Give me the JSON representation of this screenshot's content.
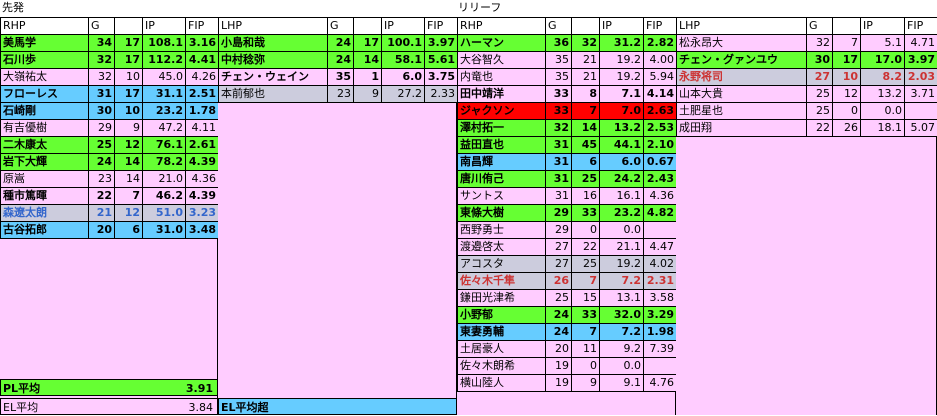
{
  "sections": {
    "starters": "先発",
    "relief": "リリーフ"
  },
  "columns": {
    "rhp": "RHP",
    "lhp": "LHP",
    "g": "G",
    "gs": "",
    "ip": "IP",
    "fip": "FIP"
  },
  "sp_rhp": [
    {
      "name": "美馬学",
      "g": "34",
      "gs": "17",
      "ip": "108.1",
      "fip": "3.16",
      "style": "g"
    },
    {
      "name": "石川歩",
      "g": "32",
      "gs": "17",
      "ip": "112.2",
      "fip": "4.41",
      "style": "g"
    },
    {
      "name": "大嶺祐太",
      "g": "32",
      "gs": "10",
      "ip": "45.0",
      "fip": "4.26",
      "style": "p"
    },
    {
      "name": "フローレス",
      "g": "31",
      "gs": "17",
      "ip": "31.1",
      "fip": "2.51",
      "style": "b"
    },
    {
      "name": "石崎剛",
      "g": "30",
      "gs": "10",
      "ip": "23.2",
      "fip": "1.78",
      "style": "b"
    },
    {
      "name": "有吉優樹",
      "g": "29",
      "gs": "9",
      "ip": "47.2",
      "fip": "4.11",
      "style": "p"
    },
    {
      "name": "二木康太",
      "g": "25",
      "gs": "12",
      "ip": "76.1",
      "fip": "2.61",
      "style": "g"
    },
    {
      "name": "岩下大輝",
      "g": "24",
      "gs": "14",
      "ip": "78.2",
      "fip": "4.39",
      "style": "g"
    },
    {
      "name": "原嵩",
      "g": "23",
      "gs": "14",
      "ip": "21.0",
      "fip": "4.36",
      "style": "p"
    },
    {
      "name": "種市篤暉",
      "g": "22",
      "gs": "7",
      "ip": "46.2",
      "fip": "4.39",
      "style": "pb"
    },
    {
      "name": "森遼太朗",
      "g": "21",
      "gs": "12",
      "ip": "51.0",
      "fip": "3.23",
      "style": "gyblue"
    },
    {
      "name": "古谷拓郎",
      "g": "20",
      "gs": "6",
      "ip": "31.0",
      "fip": "3.48",
      "style": "b"
    }
  ],
  "sp_lhp": [
    {
      "name": "小島和哉",
      "g": "24",
      "gs": "17",
      "ip": "100.1",
      "fip": "3.97",
      "style": "g"
    },
    {
      "name": "中村稔弥",
      "g": "24",
      "gs": "14",
      "ip": "58.1",
      "fip": "5.61",
      "style": "g"
    },
    {
      "name": "チェン・ウェイン",
      "g": "35",
      "gs": "1",
      "ip": "6.0",
      "fip": "3.75",
      "style": "pb"
    },
    {
      "name": "本前郁也",
      "g": "23",
      "gs": "9",
      "ip": "27.2",
      "fip": "2.33",
      "style": "gy"
    }
  ],
  "rp_rhp": [
    {
      "name": "ハーマン",
      "g": "36",
      "gs": "32",
      "ip": "31.2",
      "fip": "2.82",
      "style": "g"
    },
    {
      "name": "大谷智久",
      "g": "35",
      "gs": "21",
      "ip": "19.2",
      "fip": "4.00",
      "style": "p"
    },
    {
      "name": "内竜也",
      "g": "35",
      "gs": "21",
      "ip": "19.2",
      "fip": "5.94",
      "style": "p"
    },
    {
      "name": "田中靖洋",
      "g": "33",
      "gs": "8",
      "ip": "7.1",
      "fip": "4.14",
      "style": "pb"
    },
    {
      "name": "ジャクソン",
      "g": "33",
      "gs": "7",
      "ip": "7.0",
      "fip": "2.63",
      "style": "rd"
    },
    {
      "name": "澤村拓一",
      "g": "32",
      "gs": "14",
      "ip": "13.2",
      "fip": "2.53",
      "style": "g"
    },
    {
      "name": "益田直也",
      "g": "31",
      "gs": "45",
      "ip": "44.1",
      "fip": "2.10",
      "style": "g"
    },
    {
      "name": "南昌輝",
      "g": "31",
      "gs": "6",
      "ip": "6.0",
      "fip": "0.67",
      "style": "b"
    },
    {
      "name": "唐川侑己",
      "g": "31",
      "gs": "25",
      "ip": "24.2",
      "fip": "2.43",
      "style": "g"
    },
    {
      "name": "サントス",
      "g": "31",
      "gs": "16",
      "ip": "16.1",
      "fip": "4.36",
      "style": "p"
    },
    {
      "name": "東條大樹",
      "g": "29",
      "gs": "33",
      "ip": "23.2",
      "fip": "4.82",
      "style": "g"
    },
    {
      "name": "西野勇士",
      "g": "29",
      "gs": "0",
      "ip": "0.0",
      "fip": "",
      "style": "p"
    },
    {
      "name": "渡邉啓太",
      "g": "27",
      "gs": "22",
      "ip": "21.1",
      "fip": "4.47",
      "style": "p"
    },
    {
      "name": "アコスタ",
      "g": "27",
      "gs": "25",
      "ip": "19.2",
      "fip": "4.02",
      "style": "gy"
    },
    {
      "name": "佐々木千隼",
      "g": "26",
      "gs": "7",
      "ip": "7.2",
      "fip": "2.31",
      "style": "gyred"
    },
    {
      "name": "鎌田光津希",
      "g": "25",
      "gs": "15",
      "ip": "13.1",
      "fip": "3.58",
      "style": "p"
    },
    {
      "name": "小野郁",
      "g": "24",
      "gs": "33",
      "ip": "32.0",
      "fip": "3.29",
      "style": "g"
    },
    {
      "name": "東妻勇輔",
      "g": "24",
      "gs": "7",
      "ip": "7.2",
      "fip": "1.98",
      "style": "b"
    },
    {
      "name": "土居豪人",
      "g": "20",
      "gs": "11",
      "ip": "9.2",
      "fip": "7.39",
      "style": "p"
    },
    {
      "name": "佐々木朗希",
      "g": "19",
      "gs": "0",
      "ip": "0.0",
      "fip": "",
      "style": "p"
    },
    {
      "name": "横山陸人",
      "g": "19",
      "gs": "9",
      "ip": "9.1",
      "fip": "4.76",
      "style": "p"
    }
  ],
  "rp_lhp": [
    {
      "name": "松永昂大",
      "g": "32",
      "gs": "7",
      "ip": "5.1",
      "fip": "4.71",
      "style": "p"
    },
    {
      "name": "チェン・グァンユウ",
      "g": "30",
      "gs": "17",
      "ip": "17.0",
      "fip": "3.97",
      "style": "g"
    },
    {
      "name": "永野将司",
      "g": "27",
      "gs": "10",
      "ip": "8.2",
      "fip": "2.03",
      "style": "gyred"
    },
    {
      "name": "山本大貴",
      "g": "25",
      "gs": "12",
      "ip": "13.2",
      "fip": "3.71",
      "style": "p"
    },
    {
      "name": "土肥星也",
      "g": "25",
      "gs": "0",
      "ip": "0.0",
      "fip": "",
      "style": "p"
    },
    {
      "name": "成田翔",
      "g": "22",
      "gs": "26",
      "ip": "18.1",
      "fip": "5.07",
      "style": "p"
    }
  ],
  "summary": {
    "pl_label": "PL平均",
    "pl_value": "3.91",
    "el_label": "EL平均",
    "el_value": "3.84",
    "el_lhp_label": "EL平均超"
  }
}
